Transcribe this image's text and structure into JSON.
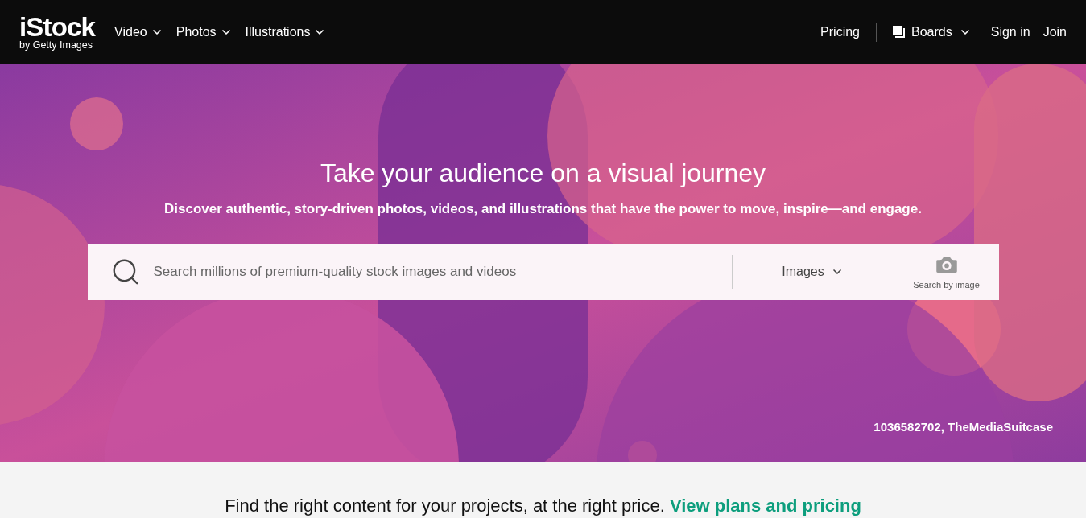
{
  "header": {
    "logo": "iStock",
    "logo_subtitle": "by Getty Images",
    "nav": [
      {
        "label": "Video"
      },
      {
        "label": "Photos"
      },
      {
        "label": "Illustrations"
      }
    ],
    "right": {
      "pricing": "Pricing",
      "boards": "Boards",
      "sign_in": "Sign in",
      "join": "Join"
    }
  },
  "hero": {
    "title": "Take your audience on a visual journey",
    "subtitle": "Discover authentic, story-driven photos, videos, and illustrations that have the power to move, inspire—and engage.",
    "search": {
      "placeholder": "Search millions of premium-quality stock images and videos",
      "type": "Images",
      "search_by_image": "Search by image"
    },
    "credit": "1036582702, TheMediaSuitcase"
  },
  "promo": {
    "text": "Find the right content for your projects, at the right price.",
    "link": "View plans and pricing"
  }
}
